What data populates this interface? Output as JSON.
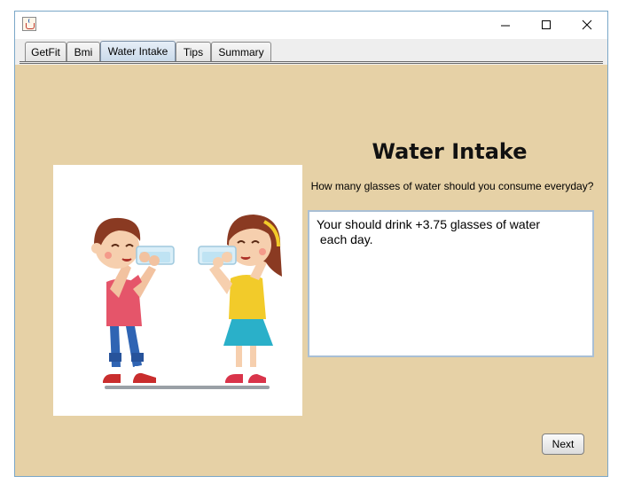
{
  "window": {
    "title": ""
  },
  "titlebar": {
    "controls": [
      "minimize",
      "maximize",
      "close"
    ]
  },
  "tabs": [
    {
      "label": "GetFit",
      "selected": false
    },
    {
      "label": "Bmi",
      "selected": false
    },
    {
      "label": "Water Intake",
      "selected": true
    },
    {
      "label": "Tips",
      "selected": false
    },
    {
      "label": "Summary",
      "selected": false
    }
  ],
  "main": {
    "heading": "Water Intake",
    "question": "How many glasses of water should you consume everyday?",
    "answer": "Your should drink +3.75 glasses of water\n each day.",
    "image": "kids-drinking-water-illustration",
    "next_label": "Next"
  },
  "colors": {
    "panel_background": "#e6d1a6",
    "selected_tab": "#c9d9ea",
    "window_border": "#7aa7c8"
  }
}
